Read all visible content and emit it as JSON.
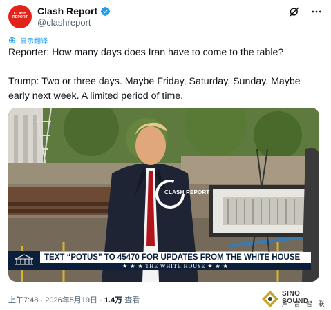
{
  "author": {
    "display_name": "Clash Report",
    "handle": "@clashreport",
    "avatar_text": "CLASH REPORT"
  },
  "header": {
    "grok_icon": "grok-icon",
    "more_icon": "more-icon"
  },
  "translate_label": "显示翻译",
  "tweet": {
    "paragraph_1": "Reporter: How many days does Iran have to come to the table?",
    "paragraph_2": "Trump: Two or three days. Maybe Friday, Saturday, Sunday. Maybe early next week. A limited period of time."
  },
  "media": {
    "overlay_logo_text": "CLASH REPORT",
    "banner_text": "TEXT “POTUS” TO 45470 FOR UPDATES FROM THE WHITE HOUSE",
    "banner_subtext": "★ ★ ★   THE WHITE HOUSE   ★ ★ ★"
  },
  "footer": {
    "time": "上午7:48",
    "separator": "·",
    "date": "2026年5月19日",
    "views_count": "1.4万",
    "views_label": "查看"
  },
  "watermark": {
    "line1": "SINO SOUND",
    "line2": "声 音 智 联"
  },
  "colors": {
    "accent": "#1d9bf0",
    "avatar_red": "#e2231a",
    "text": "#0f1419",
    "muted": "#536471",
    "banner_navy": "#0b1f3a"
  }
}
